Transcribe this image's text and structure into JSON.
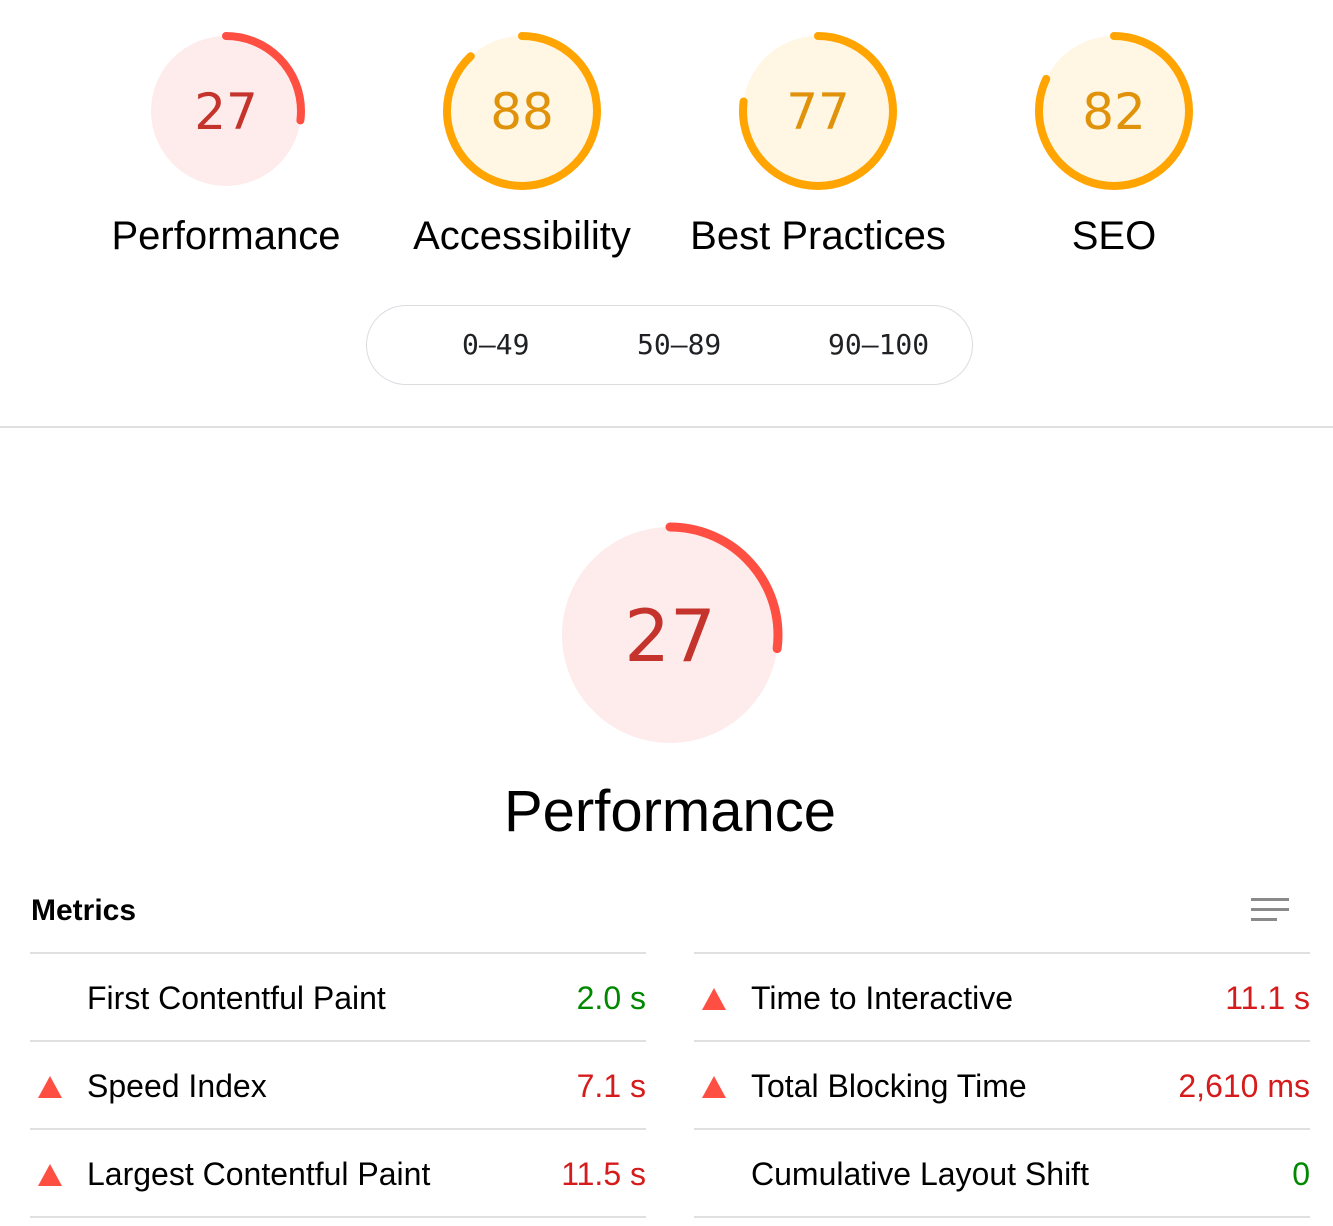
{
  "categories": [
    {
      "score": 27,
      "label": "Performance",
      "status": "fail",
      "ring_color": "#ff4e42",
      "fill_color": "#fdeceb",
      "text_color": "#c4342c"
    },
    {
      "score": 88,
      "label": "Accessibility",
      "status": "average",
      "ring_color": "#ffa400",
      "fill_color": "#fff6e3",
      "text_color": "#e0930a"
    },
    {
      "score": 77,
      "label": "Best Practices",
      "status": "average",
      "ring_color": "#ffa400",
      "fill_color": "#fff6e3",
      "text_color": "#e0930a"
    },
    {
      "score": 82,
      "label": "SEO",
      "status": "average",
      "ring_color": "#ffa400",
      "fill_color": "#fff6e3",
      "text_color": "#e0930a"
    }
  ],
  "legend": {
    "ranges": [
      "0–49",
      "50–89",
      "90–100"
    ]
  },
  "performance": {
    "score": 27,
    "title": "Performance"
  },
  "metrics": {
    "heading": "Metrics",
    "toggle_icon": "menu-lines-icon",
    "left": [
      {
        "name": "First Contentful Paint",
        "value": "2.0 s",
        "status": "pass"
      },
      {
        "name": "Speed Index",
        "value": "7.1 s",
        "status": "fail"
      },
      {
        "name": "Largest Contentful Paint",
        "value": "11.5 s",
        "status": "fail"
      }
    ],
    "right": [
      {
        "name": "Time to Interactive",
        "value": "11.1 s",
        "status": "fail"
      },
      {
        "name": "Total Blocking Time",
        "value": "2,610 ms",
        "status": "fail"
      },
      {
        "name": "Cumulative Layout Shift",
        "value": "0",
        "status": "pass"
      }
    ]
  }
}
